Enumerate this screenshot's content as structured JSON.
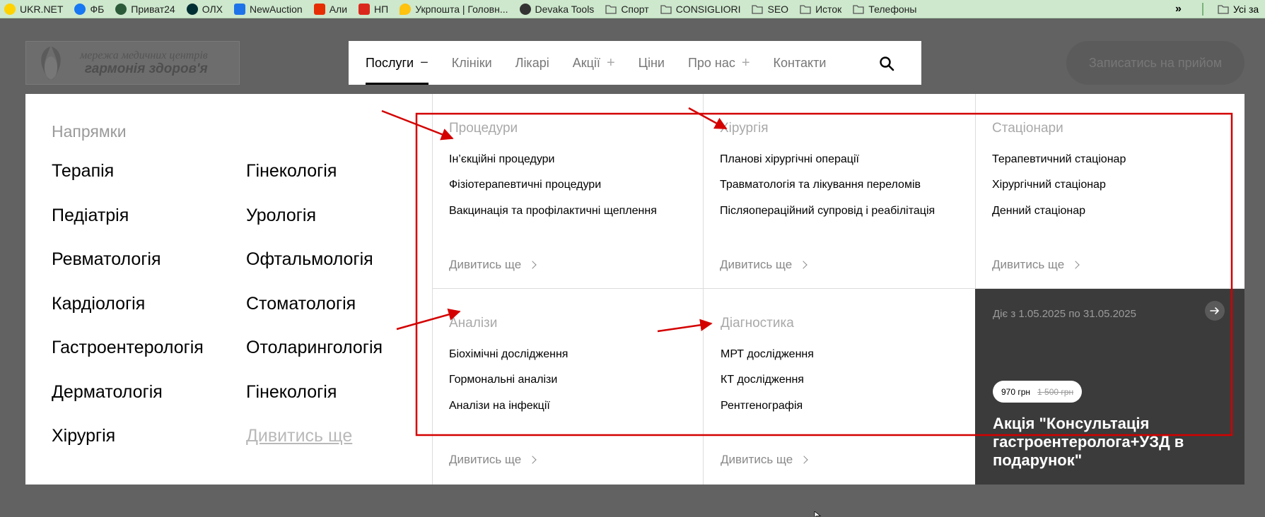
{
  "bookmarks": {
    "items": [
      {
        "label": "UKR.NET",
        "icon": "ukrnet-icon",
        "color": "#ffd200"
      },
      {
        "label": "ФБ",
        "icon": "facebook-icon",
        "color": "#1877f2"
      },
      {
        "label": "Приват24",
        "icon": "privat24-icon",
        "color": "#2c5b3a"
      },
      {
        "label": "ОЛХ",
        "icon": "olx-icon",
        "color": "#002f34"
      },
      {
        "label": "NewAuction",
        "icon": "newauction-icon",
        "color": "#1e73e8"
      },
      {
        "label": "Али",
        "icon": "aliexpress-icon",
        "color": "#e62e04"
      },
      {
        "label": "НП",
        "icon": "novaposhta-icon",
        "color": "#da291c"
      },
      {
        "label": "Укрпошта | Головн...",
        "icon": "ukrposhta-icon",
        "color": "#ffc20e"
      },
      {
        "label": "Devaka Tools",
        "icon": "devaka-icon",
        "color": "#333333"
      },
      {
        "label": "Спорт",
        "icon": "folder-icon",
        "color": "#555555"
      },
      {
        "label": "CONSIGLIORI",
        "icon": "folder-icon",
        "color": "#555555"
      },
      {
        "label": "SEO",
        "icon": "folder-icon",
        "color": "#555555"
      },
      {
        "label": "Исток",
        "icon": "folder-icon",
        "color": "#555555"
      },
      {
        "label": "Телефоны",
        "icon": "folder-icon",
        "color": "#555555"
      }
    ],
    "more": "»",
    "all_label": "Усі за"
  },
  "logo": {
    "line1": "мережа медичних центрів",
    "line2": "гармонія здоров'я"
  },
  "nav": {
    "items": [
      {
        "label": "Послуги",
        "sign": "−",
        "active": true
      },
      {
        "label": "Клініки",
        "sign": ""
      },
      {
        "label": "Лікарі",
        "sign": ""
      },
      {
        "label": "Акції",
        "sign": "+"
      },
      {
        "label": "Ціни",
        "sign": ""
      },
      {
        "label": "Про нас",
        "sign": "+"
      },
      {
        "label": "Контакти",
        "sign": ""
      }
    ]
  },
  "cta": "Записатись на прийом",
  "directions": {
    "title": "Напрямки",
    "col1": [
      "Терапія",
      "Педіатрія",
      "Ревматологія",
      "Кардіологія",
      "Гастроентерологія",
      "Дерматологія",
      "Хірургія"
    ],
    "col2": [
      "Гінекологія",
      "Урологія",
      "Офтальмологія",
      "Стоматологія",
      "Отоларингологія",
      "Гінекологія"
    ],
    "more": "Дивитись ще"
  },
  "sections": [
    {
      "title": "Процедури",
      "items": [
        "Ін’єкційні процедури",
        "Фізіотерапевтичні процедури",
        "Вакцинація та профілактичні щеплення"
      ],
      "more": "Дивитись ще"
    },
    {
      "title": "Хірургія",
      "items": [
        "Планові хірургічні операції",
        "Травматологія та лікування переломів",
        "Післяопераційний супровід і реабілітація"
      ],
      "more": "Дивитись ще"
    },
    {
      "title": "Стаціонари",
      "items": [
        "Терапевтичний стаціонар",
        "Хірургічний стаціонар",
        "Денний стаціонар"
      ],
      "more": "Дивитись ще"
    },
    {
      "title": "Аналізи",
      "items": [
        "Біохімічні дослідження",
        "Гормональні аналізи",
        "Аналізи на інфекції"
      ],
      "more": "Дивитись ще"
    },
    {
      "title": "Діагностика",
      "items": [
        "МРТ дослідження",
        "КТ дослідження",
        "Рентгенографія"
      ],
      "more": "Дивитись ще"
    }
  ],
  "promo": {
    "date": "Діє з 1.05.2025 по 31.05.2025",
    "price": "970 грн",
    "old_price": "1 500 грн",
    "title": "Акція \"Консультація гастроентеролога+УЗД в подарунок\""
  },
  "colors": {
    "annotation": "#d40000",
    "promo_bg": "#3b3b3b",
    "bookmark_bar": "#cde8cc"
  }
}
